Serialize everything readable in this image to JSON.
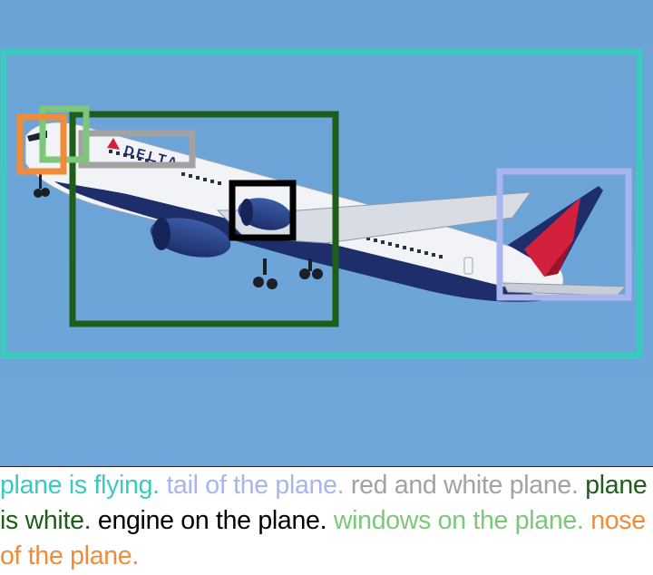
{
  "colors": {
    "sky": "#6aa3d8",
    "plane_is_flying": "#3cc9c0",
    "tail_of_the_plane": "#a9b5ee",
    "red_and_white_plane": "#a2a2a2",
    "plane_is_white": "#1f5d1a",
    "engine_on_the_plane": "#000000",
    "windows_on_the_plane": "#7dc77a",
    "nose_of_the_plane": "#f08b3a"
  },
  "livery_text": "DELTA",
  "captions": [
    {
      "text": "plane is flying.",
      "color": "#3cc9c0"
    },
    {
      "text": "tail of the plane.",
      "color": "#a9b5ee"
    },
    {
      "text": "red and white plane.",
      "color": "#a2a2a2"
    },
    {
      "text": "plane is white.",
      "color": "#1f5d1a"
    },
    {
      "text": "engine on the plane.",
      "color": "#000000"
    },
    {
      "text": "windows on the plane.",
      "color": "#7dc77a"
    },
    {
      "text": "nose of the plane.",
      "color": "#f08b3a"
    }
  ]
}
